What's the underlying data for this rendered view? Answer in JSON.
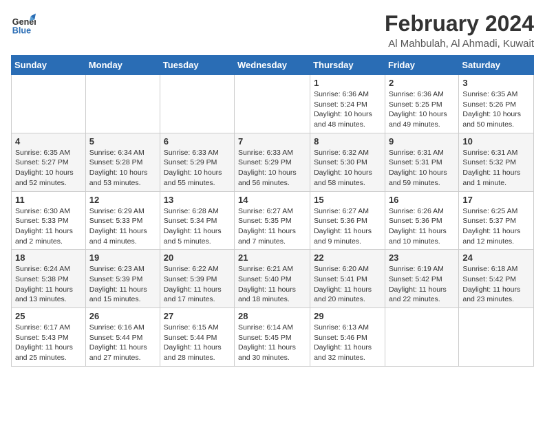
{
  "logo": {
    "line1": "General",
    "line2": "Blue"
  },
  "title": "February 2024",
  "subtitle": "Al Mahbulah, Al Ahmadi, Kuwait",
  "days_of_week": [
    "Sunday",
    "Monday",
    "Tuesday",
    "Wednesday",
    "Thursday",
    "Friday",
    "Saturday"
  ],
  "weeks": [
    [
      {
        "day": "",
        "info": ""
      },
      {
        "day": "",
        "info": ""
      },
      {
        "day": "",
        "info": ""
      },
      {
        "day": "",
        "info": ""
      },
      {
        "day": "1",
        "info": "Sunrise: 6:36 AM\nSunset: 5:24 PM\nDaylight: 10 hours and 48 minutes."
      },
      {
        "day": "2",
        "info": "Sunrise: 6:36 AM\nSunset: 5:25 PM\nDaylight: 10 hours and 49 minutes."
      },
      {
        "day": "3",
        "info": "Sunrise: 6:35 AM\nSunset: 5:26 PM\nDaylight: 10 hours and 50 minutes."
      }
    ],
    [
      {
        "day": "4",
        "info": "Sunrise: 6:35 AM\nSunset: 5:27 PM\nDaylight: 10 hours and 52 minutes."
      },
      {
        "day": "5",
        "info": "Sunrise: 6:34 AM\nSunset: 5:28 PM\nDaylight: 10 hours and 53 minutes."
      },
      {
        "day": "6",
        "info": "Sunrise: 6:33 AM\nSunset: 5:29 PM\nDaylight: 10 hours and 55 minutes."
      },
      {
        "day": "7",
        "info": "Sunrise: 6:33 AM\nSunset: 5:29 PM\nDaylight: 10 hours and 56 minutes."
      },
      {
        "day": "8",
        "info": "Sunrise: 6:32 AM\nSunset: 5:30 PM\nDaylight: 10 hours and 58 minutes."
      },
      {
        "day": "9",
        "info": "Sunrise: 6:31 AM\nSunset: 5:31 PM\nDaylight: 10 hours and 59 minutes."
      },
      {
        "day": "10",
        "info": "Sunrise: 6:31 AM\nSunset: 5:32 PM\nDaylight: 11 hours and 1 minute."
      }
    ],
    [
      {
        "day": "11",
        "info": "Sunrise: 6:30 AM\nSunset: 5:33 PM\nDaylight: 11 hours and 2 minutes."
      },
      {
        "day": "12",
        "info": "Sunrise: 6:29 AM\nSunset: 5:33 PM\nDaylight: 11 hours and 4 minutes."
      },
      {
        "day": "13",
        "info": "Sunrise: 6:28 AM\nSunset: 5:34 PM\nDaylight: 11 hours and 5 minutes."
      },
      {
        "day": "14",
        "info": "Sunrise: 6:27 AM\nSunset: 5:35 PM\nDaylight: 11 hours and 7 minutes."
      },
      {
        "day": "15",
        "info": "Sunrise: 6:27 AM\nSunset: 5:36 PM\nDaylight: 11 hours and 9 minutes."
      },
      {
        "day": "16",
        "info": "Sunrise: 6:26 AM\nSunset: 5:36 PM\nDaylight: 11 hours and 10 minutes."
      },
      {
        "day": "17",
        "info": "Sunrise: 6:25 AM\nSunset: 5:37 PM\nDaylight: 11 hours and 12 minutes."
      }
    ],
    [
      {
        "day": "18",
        "info": "Sunrise: 6:24 AM\nSunset: 5:38 PM\nDaylight: 11 hours and 13 minutes."
      },
      {
        "day": "19",
        "info": "Sunrise: 6:23 AM\nSunset: 5:39 PM\nDaylight: 11 hours and 15 minutes."
      },
      {
        "day": "20",
        "info": "Sunrise: 6:22 AM\nSunset: 5:39 PM\nDaylight: 11 hours and 17 minutes."
      },
      {
        "day": "21",
        "info": "Sunrise: 6:21 AM\nSunset: 5:40 PM\nDaylight: 11 hours and 18 minutes."
      },
      {
        "day": "22",
        "info": "Sunrise: 6:20 AM\nSunset: 5:41 PM\nDaylight: 11 hours and 20 minutes."
      },
      {
        "day": "23",
        "info": "Sunrise: 6:19 AM\nSunset: 5:42 PM\nDaylight: 11 hours and 22 minutes."
      },
      {
        "day": "24",
        "info": "Sunrise: 6:18 AM\nSunset: 5:42 PM\nDaylight: 11 hours and 23 minutes."
      }
    ],
    [
      {
        "day": "25",
        "info": "Sunrise: 6:17 AM\nSunset: 5:43 PM\nDaylight: 11 hours and 25 minutes."
      },
      {
        "day": "26",
        "info": "Sunrise: 6:16 AM\nSunset: 5:44 PM\nDaylight: 11 hours and 27 minutes."
      },
      {
        "day": "27",
        "info": "Sunrise: 6:15 AM\nSunset: 5:44 PM\nDaylight: 11 hours and 28 minutes."
      },
      {
        "day": "28",
        "info": "Sunrise: 6:14 AM\nSunset: 5:45 PM\nDaylight: 11 hours and 30 minutes."
      },
      {
        "day": "29",
        "info": "Sunrise: 6:13 AM\nSunset: 5:46 PM\nDaylight: 11 hours and 32 minutes."
      },
      {
        "day": "",
        "info": ""
      },
      {
        "day": "",
        "info": ""
      }
    ]
  ]
}
